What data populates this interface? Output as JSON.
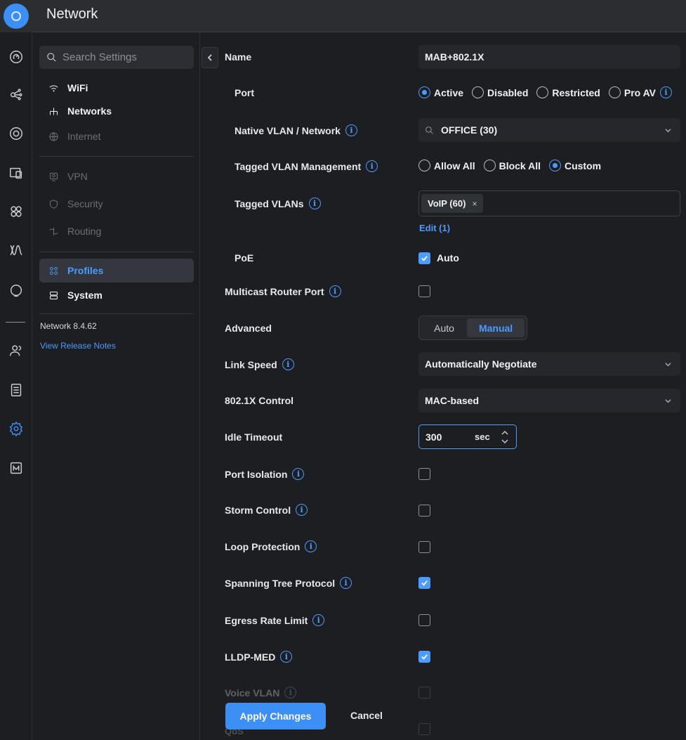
{
  "app": {
    "title": "Network"
  },
  "rail": {
    "icons": [
      "speedometer-icon",
      "topology-icon",
      "target-icon",
      "devices-icon",
      "clients-grid-icon",
      "signal-icon",
      "insights-icon",
      "users-icon",
      "logs-icon",
      "settings-icon",
      "updates-icon"
    ]
  },
  "nav": {
    "search_placeholder": "Search Settings",
    "items": [
      {
        "label": "WiFi",
        "icon": "wifi-icon",
        "state": "normal"
      },
      {
        "label": "Networks",
        "icon": "networks-icon",
        "state": "normal"
      },
      {
        "label": "Internet",
        "icon": "globe-icon",
        "state": "dim"
      },
      {
        "label": "VPN",
        "icon": "vpn-icon",
        "state": "dim"
      },
      {
        "label": "Security",
        "icon": "shield-icon",
        "state": "dim"
      },
      {
        "label": "Routing",
        "icon": "routing-icon",
        "state": "dim"
      },
      {
        "label": "Profiles",
        "icon": "profiles-icon",
        "state": "active"
      },
      {
        "label": "System",
        "icon": "system-icon",
        "state": "normal"
      }
    ],
    "version": "Network 8.4.62",
    "release_notes": "View Release Notes"
  },
  "form": {
    "name": {
      "label": "Name",
      "value": "MAB+802.1X"
    },
    "port": {
      "label": "Port",
      "options": [
        "Active",
        "Disabled",
        "Restricted",
        "Pro AV"
      ],
      "selected": "Active"
    },
    "native_vlan": {
      "label": "Native VLAN / Network",
      "value": "OFFICE (30)"
    },
    "tagged_mgmt": {
      "label": "Tagged VLAN Management",
      "options": [
        "Allow All",
        "Block All",
        "Custom"
      ],
      "selected": "Custom"
    },
    "tagged_vlans": {
      "label": "Tagged VLANs",
      "chip": "VoIP (60)",
      "chip_remove": "×",
      "edit_link": "Edit (1)"
    },
    "poe": {
      "label": "PoE",
      "checkbox_label": "Auto",
      "checked": true
    },
    "multicast": {
      "label": "Multicast Router Port",
      "checked": false
    },
    "advanced": {
      "label": "Advanced",
      "options": [
        "Auto",
        "Manual"
      ],
      "selected": "Manual"
    },
    "link_speed": {
      "label": "Link Speed",
      "value": "Automatically Negotiate"
    },
    "dot1x": {
      "label": "802.1X Control",
      "value": "MAC-based"
    },
    "idle_timeout": {
      "label": "Idle Timeout",
      "value": "300",
      "unit": "sec"
    },
    "port_isolation": {
      "label": "Port Isolation",
      "checked": false
    },
    "storm_control": {
      "label": "Storm Control",
      "checked": false
    },
    "loop_protection": {
      "label": "Loop Protection",
      "checked": false
    },
    "stp": {
      "label": "Spanning Tree Protocol",
      "checked": true
    },
    "egress": {
      "label": "Egress Rate Limit",
      "checked": false
    },
    "lldp": {
      "label": "LLDP-MED",
      "checked": true
    },
    "voice_vlan": {
      "label": "Voice VLAN",
      "checked": false
    },
    "bottom_partial": {
      "label": "QoS"
    }
  },
  "footer": {
    "apply": "Apply Changes",
    "cancel": "Cancel"
  },
  "colors": {
    "accent": "#3c8ff4",
    "background": "#1c1e22",
    "topbar": "#2b2d31"
  }
}
